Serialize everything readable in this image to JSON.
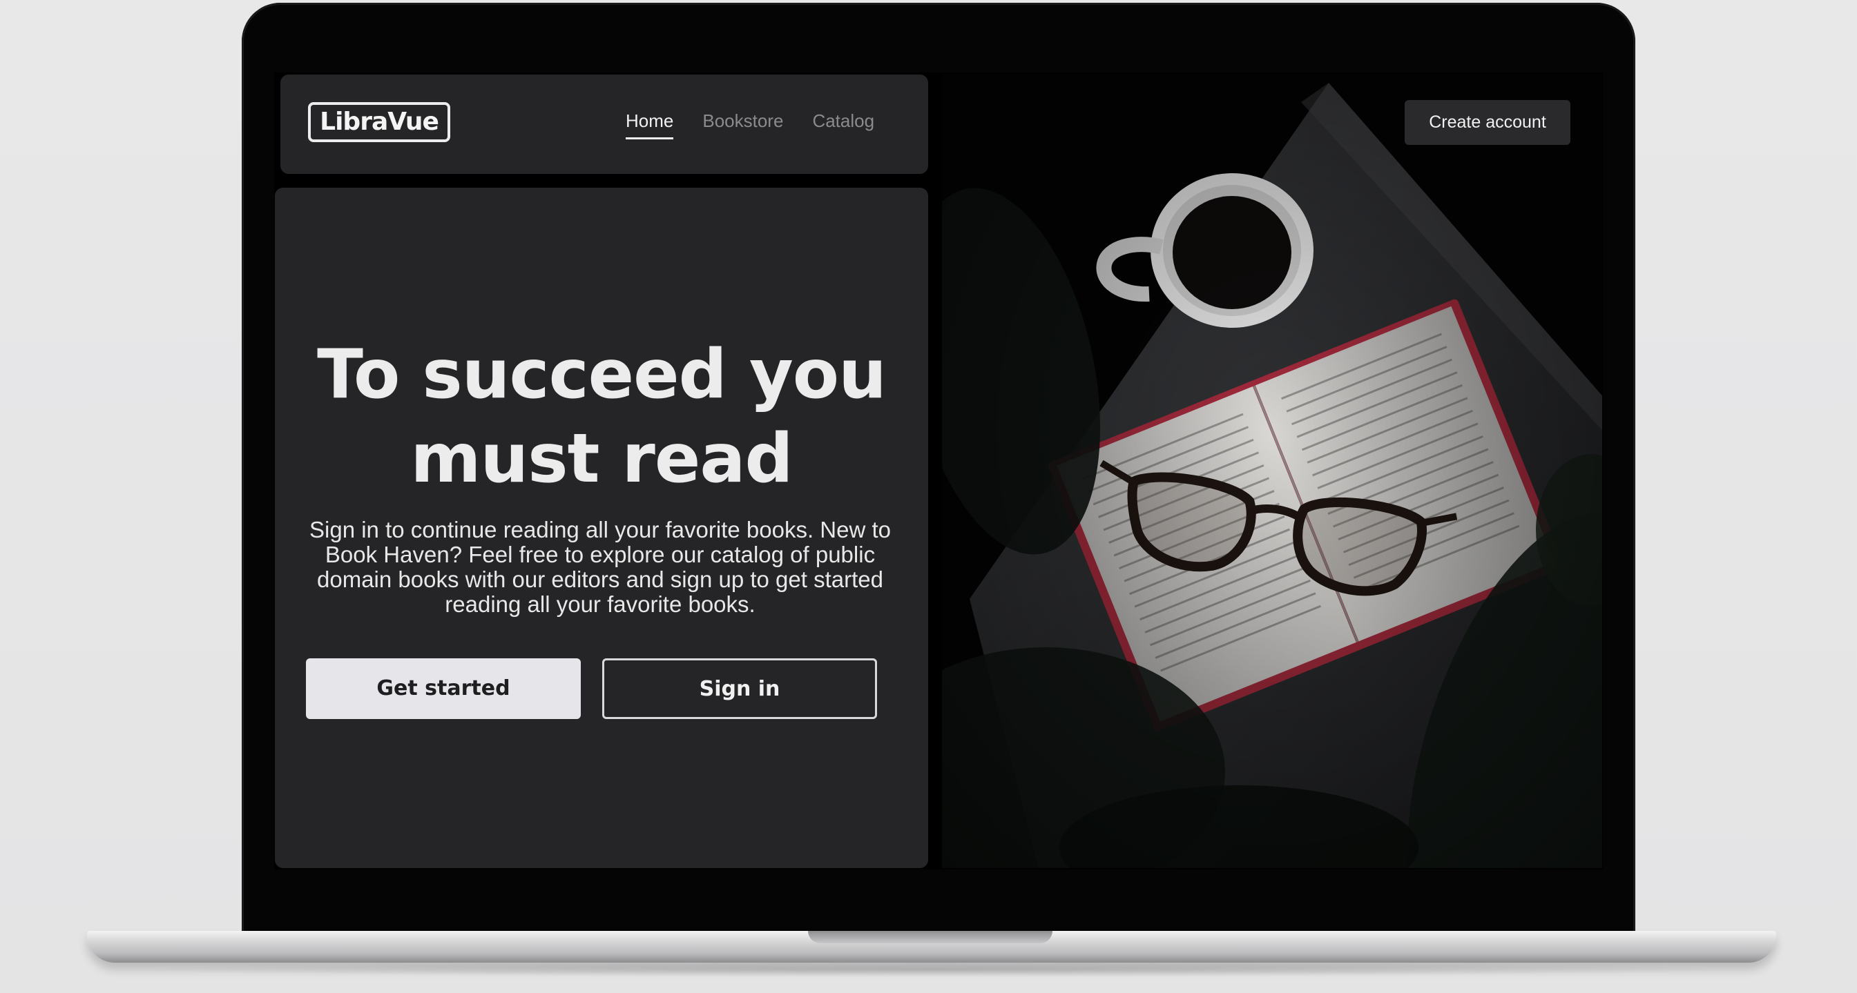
{
  "brand": {
    "logo_text": "LibraVue"
  },
  "nav": {
    "items": [
      {
        "label": "Home",
        "active": true
      },
      {
        "label": "Bookstore",
        "active": false
      },
      {
        "label": "Catalog",
        "active": false
      }
    ]
  },
  "header": {
    "create_account_label": "Create account"
  },
  "hero": {
    "title_line1": "To succeed you",
    "title_line2": "must read",
    "description": "Sign in to continue reading all your favorite books. New to Book Haven? Feel free to explore  our catalog of public domain books with our editors and sign up to get started reading all your favorite books.",
    "primary_button_label": "Get started",
    "secondary_button_label": "Sign in"
  },
  "colors": {
    "card_bg": "#252527",
    "text": "#ececec",
    "muted_text": "#8b8b8e",
    "primary_button_bg": "#e6e6ea",
    "accent_book_edge": "#a32a3c"
  },
  "photo": {
    "subject_icon": "book-coffee-glasses-photo"
  }
}
